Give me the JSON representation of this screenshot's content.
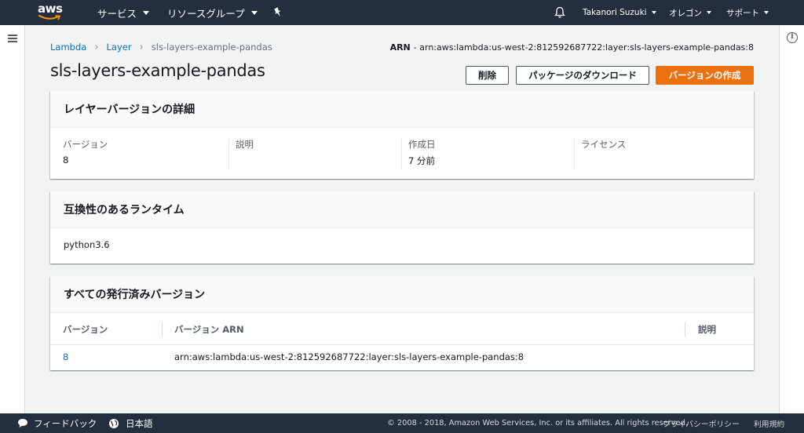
{
  "topnav": {
    "logo_text": "aws",
    "services": "サービス",
    "resource_groups": "リソースグループ",
    "pin_icon": "pin-icon",
    "bell_icon": "bell-icon",
    "user": "Takanori Suzuki",
    "region": "オレゴン",
    "support": "サポート"
  },
  "breadcrumb": {
    "items": [
      "Lambda",
      "Layer",
      "sls-layers-example-pandas"
    ]
  },
  "arn": {
    "label": "ARN",
    "value": "- arn:aws:lambda:us-west-2:812592687722:layer:sls-layers-example-pandas:8"
  },
  "page": {
    "title": "sls-layers-example-pandas"
  },
  "buttons": {
    "delete": "削除",
    "download": "パッケージのダウンロード",
    "create_version": "バージョンの作成"
  },
  "details": {
    "title": "レイヤーバージョンの詳細",
    "columns": [
      {
        "label": "バージョン",
        "value": "8"
      },
      {
        "label": "説明",
        "value": ""
      },
      {
        "label": "作成日",
        "value": "7 分前"
      },
      {
        "label": "ライセンス",
        "value": ""
      }
    ]
  },
  "runtimes": {
    "title": "互換性のあるランタイム",
    "values": [
      "python3.6"
    ]
  },
  "versions": {
    "title": "すべての発行済みバージョン",
    "headers": [
      "バージョン",
      "バージョン ARN",
      "説明"
    ],
    "rows": [
      {
        "version": "8",
        "arn": "arn:aws:lambda:us-west-2:812592687722:layer:sls-layers-example-pandas:8",
        "description": ""
      }
    ]
  },
  "footer": {
    "feedback": "フィードバック",
    "language": "日本語",
    "copyright": "© 2008 - 2018, Amazon Web Services, Inc. or its affiliates. All rights reserved.",
    "privacy": "プライバシーポリシー",
    "terms": "利用規約"
  },
  "colors": {
    "nav_bg": "#232f3e",
    "primary": "#ec7211",
    "link": "#0073bb",
    "page_bg": "#f2f3f3"
  }
}
